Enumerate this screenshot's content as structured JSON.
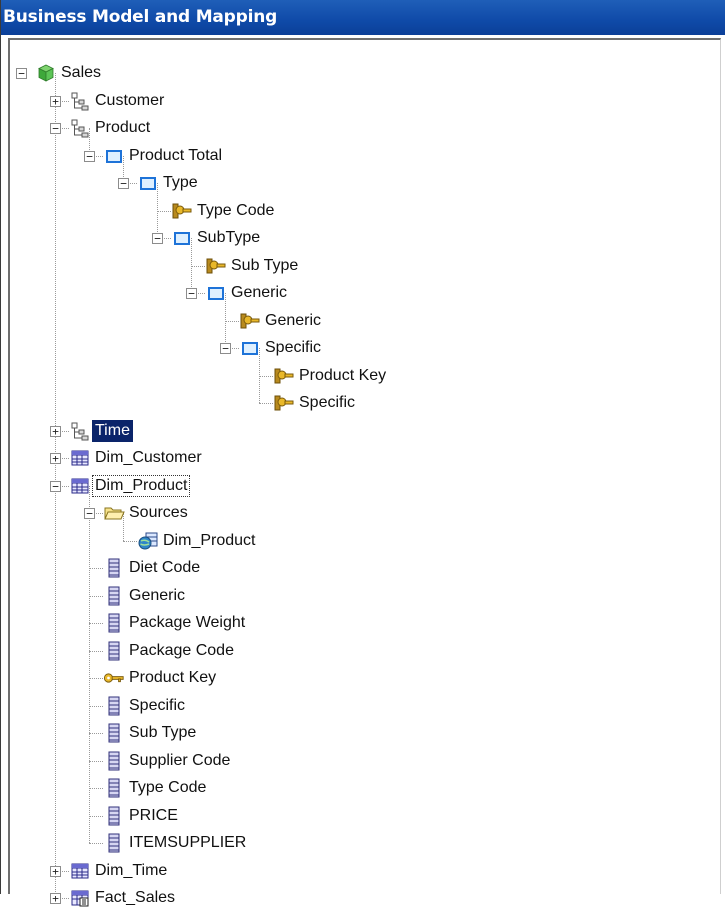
{
  "window": {
    "title": "Business Model and Mapping"
  },
  "tree": {
    "nodes": [
      {
        "label": "Sales",
        "icon": "business-model-cube-icon",
        "expanded": true,
        "depth": 0
      },
      {
        "label": "Customer",
        "icon": "dimension-hierarchy-icon",
        "expanded": false,
        "depth": 1
      },
      {
        "label": "Product",
        "icon": "dimension-hierarchy-icon",
        "expanded": true,
        "depth": 1
      },
      {
        "label": "Product Total",
        "icon": "level-icon",
        "expanded": true,
        "depth": 2
      },
      {
        "label": "Type",
        "icon": "level-icon",
        "expanded": true,
        "depth": 3
      },
      {
        "label": "Type Code",
        "icon": "level-key-icon",
        "depth": 4
      },
      {
        "label": "SubType",
        "icon": "level-icon",
        "expanded": true,
        "depth": 4
      },
      {
        "label": "Sub Type",
        "icon": "level-key-icon",
        "depth": 5
      },
      {
        "label": "Generic",
        "icon": "level-icon",
        "expanded": true,
        "depth": 5
      },
      {
        "label": "Generic",
        "icon": "level-key-icon",
        "depth": 6
      },
      {
        "label": "Specific",
        "icon": "level-icon",
        "expanded": true,
        "depth": 6
      },
      {
        "label": "Product Key",
        "icon": "level-key-icon",
        "depth": 7
      },
      {
        "label": "Specific",
        "icon": "level-key-icon",
        "depth": 7
      },
      {
        "label": "Time",
        "icon": "dimension-hierarchy-icon",
        "expanded": false,
        "depth": 1,
        "selected": true
      },
      {
        "label": "Dim_Customer",
        "icon": "logical-table-icon",
        "expanded": false,
        "depth": 1
      },
      {
        "label": "Dim_Product",
        "icon": "logical-table-icon",
        "expanded": true,
        "depth": 1,
        "focused": true
      },
      {
        "label": "Sources",
        "icon": "folder-open-icon",
        "expanded": true,
        "depth": 2
      },
      {
        "label": "Dim_Product",
        "icon": "logical-table-source-icon",
        "depth": 3
      },
      {
        "label": "Diet Code",
        "icon": "logical-column-icon",
        "depth": 2
      },
      {
        "label": "Generic",
        "icon": "logical-column-icon",
        "depth": 2
      },
      {
        "label": "Package Weight",
        "icon": "logical-column-icon",
        "depth": 2
      },
      {
        "label": "Package Code",
        "icon": "logical-column-icon",
        "depth": 2
      },
      {
        "label": "Product Key",
        "icon": "key-column-icon",
        "depth": 2
      },
      {
        "label": "Specific",
        "icon": "logical-column-icon",
        "depth": 2
      },
      {
        "label": "Sub Type",
        "icon": "logical-column-icon",
        "depth": 2
      },
      {
        "label": "Supplier Code",
        "icon": "logical-column-icon",
        "depth": 2
      },
      {
        "label": "Type Code",
        "icon": "logical-column-icon",
        "depth": 2
      },
      {
        "label": "PRICE",
        "icon": "logical-column-icon",
        "depth": 2
      },
      {
        "label": "ITEMSUPPLIER",
        "icon": "logical-column-icon",
        "depth": 2
      },
      {
        "label": "Dim_Time",
        "icon": "logical-table-icon",
        "expanded": false,
        "depth": 1
      },
      {
        "label": "Fact_Sales",
        "icon": "fact-table-icon",
        "expanded": false,
        "depth": 1
      }
    ]
  },
  "colors": {
    "titlebar": "#0f4aa8",
    "selection": "#0a246a"
  }
}
